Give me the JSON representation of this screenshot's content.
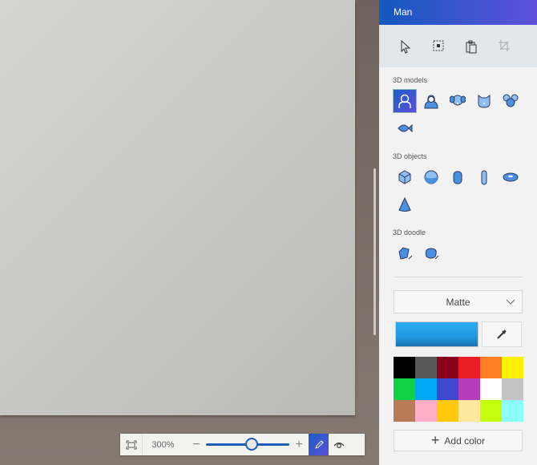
{
  "panel": {
    "title": "Man",
    "tools": [
      {
        "name": "select-icon"
      },
      {
        "name": "crop-select-icon"
      },
      {
        "name": "paste-icon"
      },
      {
        "name": "crop-icon"
      }
    ],
    "sections": [
      {
        "label": "3D models",
        "items": [
          "man",
          "woman",
          "dog",
          "cat",
          "mouse",
          "fish"
        ],
        "selected": "man"
      },
      {
        "label": "3D objects",
        "items": [
          "cube",
          "sphere",
          "cylinder",
          "capsule",
          "donut",
          "cone"
        ]
      },
      {
        "label": "3D doodle",
        "items": [
          "sharp-edge-doodle",
          "soft-edge-doodle"
        ]
      }
    ],
    "material": "Matte",
    "current_color": "#209ae0",
    "palette": [
      "#000000",
      "#585858",
      "#88001b",
      "#ec1c24",
      "#ff7f27",
      "#fff200",
      "#0ed145",
      "#00a8f3",
      "#3f48cc",
      "#b83dba",
      "#ffffff",
      "#c3c3c3",
      "#b97a56",
      "#ffaec8",
      "#ffc90e",
      "#fde89e",
      "#c4ff0e",
      "#8cfffb"
    ],
    "add_color": "Add color"
  },
  "zoom": {
    "label": "300%",
    "slider_fraction": 0.55
  }
}
